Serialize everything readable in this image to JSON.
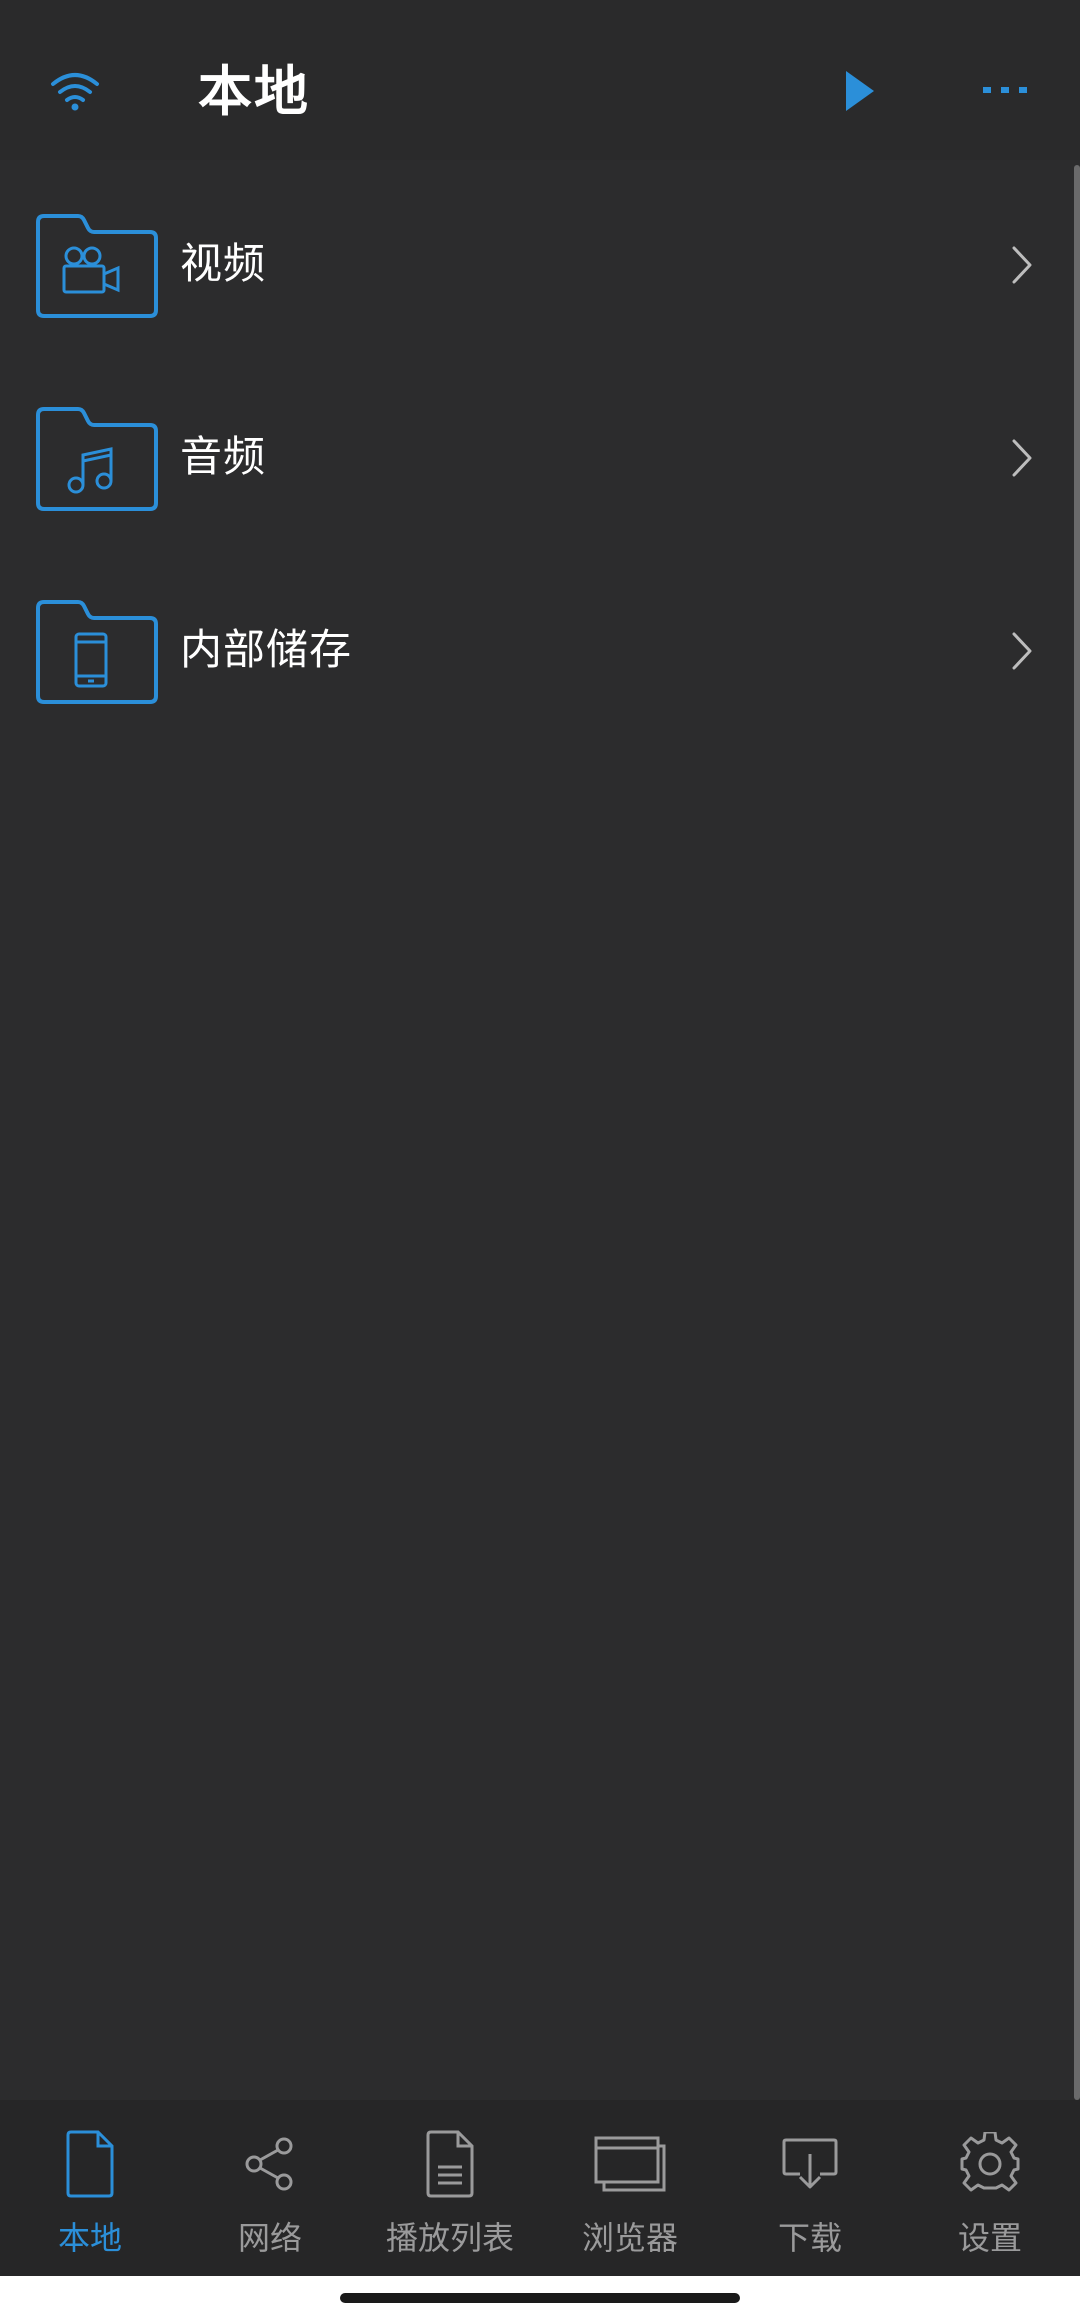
{
  "header": {
    "title": "本地",
    "wifi_icon": "wifi-icon",
    "play_icon": "play-icon",
    "more_icon": "more-dots-icon"
  },
  "colors": {
    "accent": "#2b8fd9",
    "background": "#2c2c2d",
    "header_bg": "#2a2a2b",
    "tabbar_bg": "#262627",
    "text": "#ffffff",
    "muted": "#9a9a9b"
  },
  "folders": [
    {
      "label": "视频",
      "icon": "video-folder-icon"
    },
    {
      "label": "音频",
      "icon": "music-folder-icon"
    },
    {
      "label": "内部储存",
      "icon": "phone-folder-icon"
    }
  ],
  "tabs": [
    {
      "label": "本地",
      "icon": "document-icon",
      "active": true
    },
    {
      "label": "网络",
      "icon": "share-icon",
      "active": false
    },
    {
      "label": "播放列表",
      "icon": "playlist-icon",
      "active": false
    },
    {
      "label": "浏览器",
      "icon": "browser-icon",
      "active": false
    },
    {
      "label": "下载",
      "icon": "download-icon",
      "active": false
    },
    {
      "label": "设置",
      "icon": "gear-icon",
      "active": false
    }
  ]
}
